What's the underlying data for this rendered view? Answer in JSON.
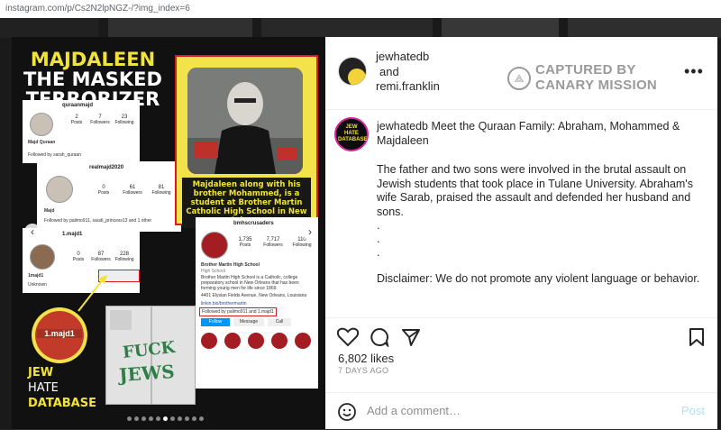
{
  "browser": {
    "url": "instagram.com/p/Cs2N2lpNGZ-/?img_index=6"
  },
  "image": {
    "title_line1": "MAJDALEEN",
    "title_line2": "THE MASKED",
    "title_line3": "TERRORIZER",
    "photo_caption": "Majdaleen along with his brother Mohammed, is a student at Brother Martin Catholic High School in New Orleans",
    "cards": [
      {
        "handle": "quraanmajd",
        "posts": "2",
        "followers": "7",
        "following": "23",
        "posts_label": "Posts",
        "followers_label": "Followers",
        "following_label": "Following",
        "name": "Majd Quraan",
        "followed_by": "Followed by sarah_quraan"
      },
      {
        "handle": "realmajd2020",
        "posts": "0",
        "followers": "61",
        "following": "81",
        "posts_label": "Posts",
        "followers_label": "Followers",
        "following_label": "Following",
        "name": "Majd",
        "followed_by": "Followed by palimo911, saudi_princess13 and 1 other"
      },
      {
        "handle": "1.majd1",
        "posts": "0",
        "followers": "87",
        "following": "228",
        "posts_label": "Posts",
        "followers_label": "Followers",
        "following_label": "Following",
        "name": "1majd1",
        "bio": "Unknown"
      }
    ],
    "school": {
      "handle": "bmhscrusaders",
      "posts": "1,735",
      "followers": "7,717",
      "following": "110",
      "posts_label": "Posts",
      "followers_label": "Followers",
      "following_label": "Following",
      "name": "Brother Martin High School",
      "category": "High School",
      "bio": "Brother Martin High School is a Catholic, college preparatory school in New Orleans that has been forming young men for life since 1869.",
      "address": "4401 Elysian Fields Avenue, New Orleans, Louisiana",
      "link": "linkin.bio/brothermartin",
      "followed_by": "Followed by palimo911 and 1.majd1",
      "follow_btn": "Follow",
      "message_btn": "Message",
      "call_btn": "Call"
    },
    "badge_label": "1.majd1",
    "graffiti_text_1": "FUCK",
    "graffiti_text_2": "JEWS",
    "brand_line1": "JEW",
    "brand_line2": "HATE",
    "brand_line3": "DATABASE",
    "accent_yellow": "#f2e33a",
    "accent_red": "#d61c1c"
  },
  "post": {
    "user1": "jewhatedb",
    "and": "and",
    "user2": "remi.franklin",
    "captured_line1": "CAPTURED BY",
    "captured_line2": "CANARY MISSION",
    "avatar_text": "JEW HATE DATABASE",
    "caption_user": "jewhatedb",
    "caption_text": "Meet the Quraan Family: Abraham, Mohammed & Majdaleen",
    "paragraph": "The father and two sons were involved in the brutal assault on Jewish students that took place in Tulane University. Abraham's wife Sarab, praised the assault and defended her husband and sons.",
    "dot1": ".",
    "dot2": ".",
    "dot3": ".",
    "disclaimer": "Disclaimer: We do not promote any violent language or behavior.",
    "likes": "6,802 likes",
    "date": "7 DAYS AGO",
    "comment_placeholder": "Add a comment…",
    "post_label": "Post"
  },
  "icons": [
    "heart-icon",
    "comment-icon",
    "share-icon",
    "bookmark-icon",
    "emoji-icon",
    "more-icon",
    "canary-icon",
    "chevron-left-icon",
    "chevron-right-icon"
  ]
}
